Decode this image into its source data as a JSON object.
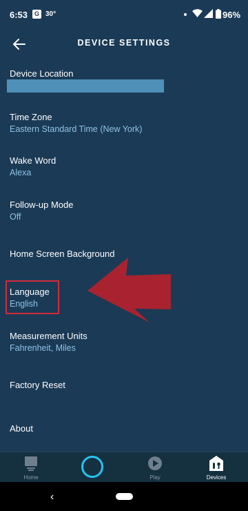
{
  "status_bar": {
    "time": "6:53",
    "app_icon_letter": "G",
    "temperature": "30°",
    "battery": "96%"
  },
  "header": {
    "title": "DEVICE SETTINGS"
  },
  "settings": [
    {
      "label": "Device Location",
      "value": ""
    },
    {
      "label": "Time Zone",
      "value": "Eastern Standard Time (New York)"
    },
    {
      "label": "Wake Word",
      "value": "Alexa"
    },
    {
      "label": "Follow-up Mode",
      "value": "Off"
    },
    {
      "label": "Home Screen Background",
      "value": ""
    },
    {
      "label": "Language",
      "value": "English"
    },
    {
      "label": "Measurement Units",
      "value": "Fahrenheit, Miles"
    },
    {
      "label": "Factory Reset",
      "value": ""
    },
    {
      "label": "About",
      "value": ""
    }
  ],
  "annotation": {
    "highlight_color": "#d42b37",
    "arrow_color": "#a8232f"
  },
  "bottom_nav": {
    "home": "Home",
    "play": "Play",
    "devices": "Devices",
    "active": "Devices"
  },
  "colors": {
    "background": "#1b3a56",
    "value_text": "#8fc3e6",
    "alexa_ring": "#24c4ef",
    "location_redaction": "#4e90b8"
  },
  "icons": {
    "back": "arrow-left-icon",
    "home": "home-icon",
    "alexa": "alexa-ring-icon",
    "play": "play-icon",
    "devices": "devices-icon",
    "wifi": "wifi-icon",
    "signal": "signal-icon",
    "battery": "battery-icon"
  }
}
